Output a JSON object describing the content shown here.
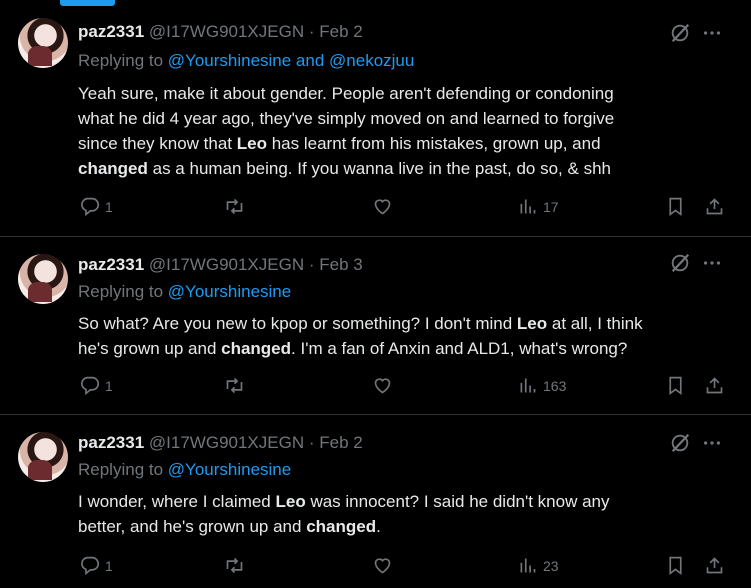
{
  "tweets": [
    {
      "display_name": "paz2331",
      "handle": "@I17WG901XJEGN",
      "date": "Feb 2",
      "replying_prefix": "Replying to ",
      "replying_to": "@Yourshinesine and @nekozjuu",
      "body": [
        {
          "t": "Yeah sure, make it about gender. People aren't defending or condoning\nwhat he did 4 year ago, they've simply moved on and learned to forgive\nsince they know that "
        },
        {
          "t": "Leo",
          "b": true
        },
        {
          "t": " has learnt from his mistakes, grown up, and\n"
        },
        {
          "t": "changed",
          "b": true
        },
        {
          "t": " as a human being. If you wanna live in the past,  do so, & shh"
        }
      ],
      "replies": "1",
      "views": "17"
    },
    {
      "display_name": "paz2331",
      "handle": "@I17WG901XJEGN",
      "date": "Feb 3",
      "replying_prefix": "Replying to ",
      "replying_to": "@Yourshinesine",
      "body": [
        {
          "t": "So what? Are you new to kpop or something? I don't mind "
        },
        {
          "t": "Leo",
          "b": true
        },
        {
          "t": " at all, I think\nhe's grown up and "
        },
        {
          "t": "changed",
          "b": true
        },
        {
          "t": ". I'm a fan of Anxin and ALD1, what's wrong?"
        }
      ],
      "replies": "1",
      "views": "163"
    },
    {
      "display_name": "paz2331",
      "handle": "@I17WG901XJEGN",
      "date": "Feb 2",
      "replying_prefix": "Replying to ",
      "replying_to": "@Yourshinesine",
      "body": [
        {
          "t": "I wonder, where I claimed "
        },
        {
          "t": "Leo",
          "b": true
        },
        {
          "t": " was innocent? I said he didn't know any\nbetter, and he's grown up and "
        },
        {
          "t": "changed",
          "b": true
        },
        {
          "t": "."
        }
      ],
      "replies": "1",
      "views": "23"
    }
  ],
  "icons": [
    "grok-icon",
    "more-icon",
    "reply-icon",
    "retweet-icon",
    "like-icon",
    "views-icon",
    "bookmark-icon",
    "share-icon"
  ],
  "colors": {
    "background": "#000000",
    "text": "#e7e9ea",
    "muted": "#71767b",
    "link": "#1d9bf0",
    "divider": "#2f3336"
  }
}
